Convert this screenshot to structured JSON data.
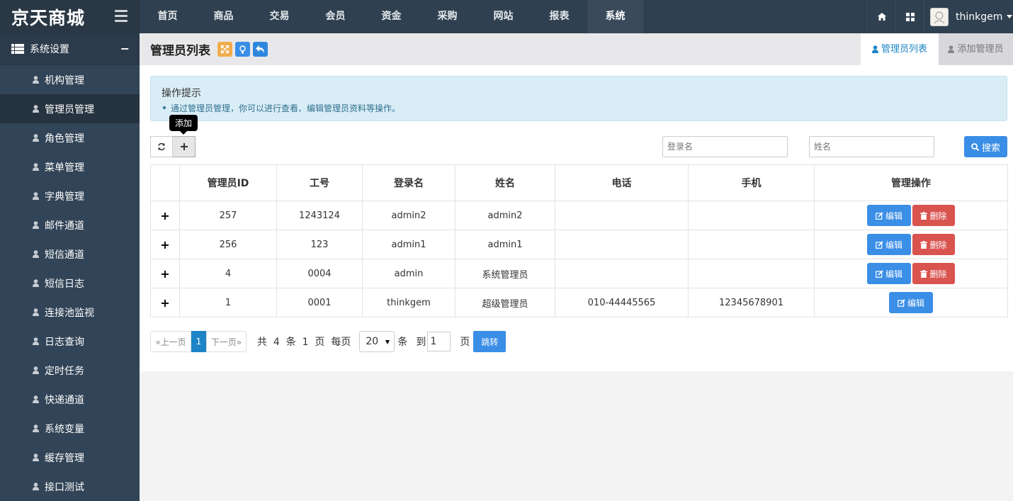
{
  "brand": {
    "name": "京天商城"
  },
  "nav": {
    "items": [
      "首页",
      "商品",
      "交易",
      "会员",
      "资金",
      "采购",
      "网站",
      "报表",
      "系统"
    ],
    "active_index": 8
  },
  "user": {
    "name": "thinkgem"
  },
  "sidebar": {
    "section": "系统设置",
    "collapse_symbol": "−",
    "items": [
      "机构管理",
      "管理员管理",
      "角色管理",
      "菜单管理",
      "字典管理",
      "邮件通道",
      "短信通道",
      "短信日志",
      "连接池监视",
      "日志查询",
      "定时任务",
      "快递通道",
      "系统变量",
      "缓存管理",
      "接口测试"
    ],
    "active_index": 1
  },
  "header": {
    "title": "管理员列表",
    "tabs": [
      "管理员列表",
      "添加管理员"
    ]
  },
  "alert": {
    "title": "操作提示",
    "items": [
      "通过管理员管理，你可以进行查看、编辑管理员资料等操作。"
    ]
  },
  "toolbar": {
    "add_tooltip": "添加"
  },
  "search": {
    "login_placeholder": "登录名",
    "name_placeholder": "姓名",
    "button_label": "搜索"
  },
  "table": {
    "columns": [
      "",
      "管理员ID",
      "工号",
      "登录名",
      "姓名",
      "电话",
      "手机",
      "管理操作"
    ],
    "expand_symbol": "+",
    "rows": [
      {
        "id": "257",
        "no": "1243124",
        "login": "admin2",
        "name": "admin2",
        "phone": "",
        "mobile": "",
        "deletable": true
      },
      {
        "id": "256",
        "no": "123",
        "login": "admin1",
        "name": "admin1",
        "phone": "",
        "mobile": "",
        "deletable": true
      },
      {
        "id": "4",
        "no": "0004",
        "login": "admin",
        "name": "系统管理员",
        "phone": "",
        "mobile": "",
        "deletable": true
      },
      {
        "id": "1",
        "no": "0001",
        "login": "thinkgem",
        "name": "超级管理员",
        "phone": "010-44445565",
        "mobile": "12345678901",
        "deletable": false
      }
    ],
    "edit_label": "编辑",
    "delete_label": "删除"
  },
  "pager": {
    "prev": "«上一页",
    "current": "1",
    "next": "下一页»",
    "info_total": "共  4  条  1  页  每页",
    "page_size": "20",
    "unit_tiao": "条",
    "goto_label": "到",
    "goto_value": "1",
    "page_label": "页",
    "jump_label": "跳转"
  },
  "colors": {
    "topbar": "#2f4050",
    "sidebar": "#324457",
    "primary": "#3a8ee6",
    "danger": "#d9534f",
    "alert": "#d9edf7"
  }
}
